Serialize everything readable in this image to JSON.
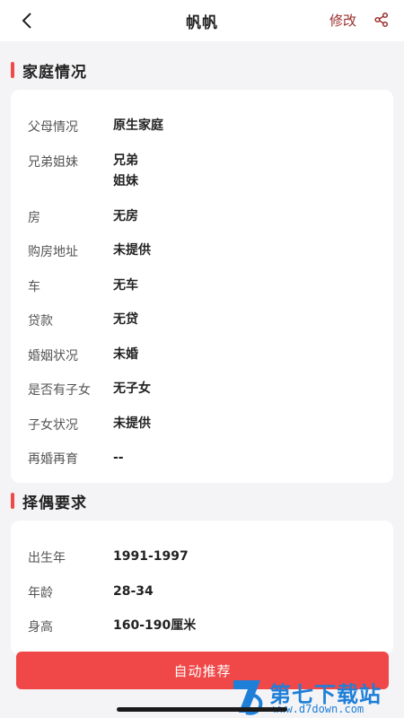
{
  "header": {
    "title": "帆帆",
    "edit_label": "修改"
  },
  "family": {
    "title": "家庭情况",
    "rows": [
      {
        "label": "父母情况",
        "value": "原生家庭"
      },
      {
        "label": "兄弟姐妹",
        "value": "兄弟",
        "value2": "姐妹"
      },
      {
        "label": "房",
        "value": "无房"
      },
      {
        "label": "购房地址",
        "value": "未提供"
      },
      {
        "label": "车",
        "value": "无车"
      },
      {
        "label": "贷款",
        "value": "无贷"
      },
      {
        "label": "婚姻状况",
        "value": "未婚"
      },
      {
        "label": "是否有子女",
        "value": "无子女"
      },
      {
        "label": "子女状况",
        "value": "未提供"
      },
      {
        "label": "再婚再育",
        "value": "--"
      }
    ]
  },
  "partner": {
    "title": "择偶要求",
    "rows": [
      {
        "label": "出生年",
        "value": "1991-1997"
      },
      {
        "label": "年龄",
        "value": "28-34"
      },
      {
        "label": "身高",
        "value": "160-190厘米"
      }
    ]
  },
  "footer": {
    "recommend_label": "自动推荐"
  },
  "watermark": {
    "cn": "第七下载站",
    "url": "www.d7down.com"
  },
  "colors": {
    "accent": "#f04848",
    "edit": "#9b2d2d",
    "watermark": "#1e7fd8"
  }
}
